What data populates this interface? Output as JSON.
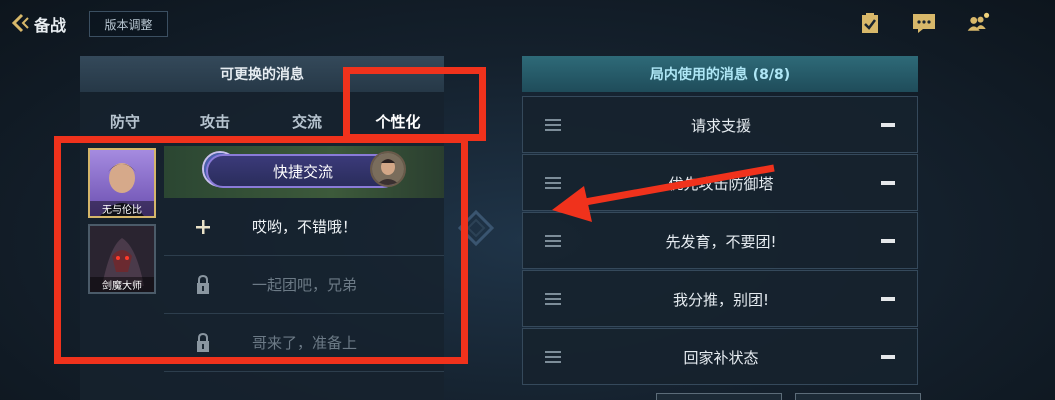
{
  "topbar": {
    "back_icon": "chevron-left-icon",
    "title": "备战",
    "version_button": "版本调整",
    "icons": [
      "checklist-icon",
      "chat-bubble-icon",
      "friends-icon"
    ]
  },
  "left_panel": {
    "header": "可更换的消息",
    "tabs": [
      {
        "label": "防守",
        "active": false
      },
      {
        "label": "攻击",
        "active": false
      },
      {
        "label": "交流",
        "active": false
      },
      {
        "label": "个性化",
        "active": true
      }
    ],
    "heroes": [
      {
        "label": "无与伦比",
        "active": true
      },
      {
        "label": "剑魔大师",
        "active": false
      }
    ],
    "quick_chat_label": "快捷交流",
    "messages": [
      {
        "text": "哎哟，不错哦！",
        "state": "unlocked",
        "icon": "plus-icon"
      },
      {
        "text": "一起团吧，兄弟",
        "state": "locked",
        "icon": "lock-icon"
      },
      {
        "text": "哥来了，准备上",
        "state": "locked",
        "icon": "lock-icon"
      }
    ]
  },
  "right_panel": {
    "header": "局内使用的消息 (8/8)",
    "messages": [
      {
        "text": "请求支援"
      },
      {
        "text": "优先攻击防御塔"
      },
      {
        "text": "先发育，不要团!"
      },
      {
        "text": "我分推，别团!"
      },
      {
        "text": "回家补状态"
      }
    ]
  },
  "colors": {
    "highlight_red": "#f0321c",
    "gold_accent": "#d9c27a",
    "right_header_text": "#aee6f5"
  }
}
